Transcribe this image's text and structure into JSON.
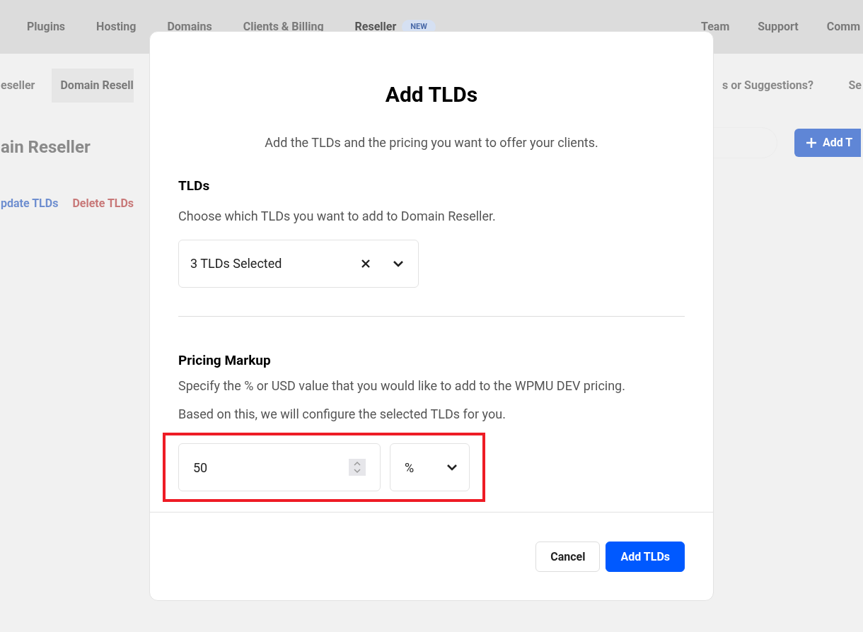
{
  "nav": {
    "items": [
      {
        "label": "Plugins",
        "selected": false
      },
      {
        "label": "Hosting",
        "selected": false
      },
      {
        "label": "Domains",
        "selected": false
      },
      {
        "label": "Clients & Billing",
        "selected": false
      },
      {
        "label": "Reseller",
        "selected": true,
        "badge": "NEW"
      }
    ],
    "right_items": [
      {
        "label": "Team",
        "selected": false
      },
      {
        "label": "Support",
        "selected": false
      },
      {
        "label": "Comm",
        "selected": false
      }
    ]
  },
  "subnav": {
    "left": [
      {
        "label": "eseller",
        "selected": false
      },
      {
        "label": "Domain Resell",
        "selected": true
      }
    ],
    "right": [
      "s or Suggestions?",
      "Se"
    ]
  },
  "page": {
    "title": "ain Reseller",
    "actions": [
      {
        "label": "pdate TLDs",
        "kind": "link"
      },
      {
        "label": "Delete TLDs",
        "kind": "danger"
      }
    ],
    "add_button": "Add T"
  },
  "modal": {
    "title": "Add TLDs",
    "description": "Add the TLDs and the pricing you want to offer your clients.",
    "tlds": {
      "heading": "TLDs",
      "description": "Choose which TLDs you want to add to Domain Reseller.",
      "select": {
        "value": "3 TLDs Selected"
      }
    },
    "pricing": {
      "heading": "Pricing Markup",
      "description": "Specify the % or USD value that you would like to add to the WPMU DEV pricing. Based on this, we will configure the selected TLDs for you.",
      "value": "50",
      "unit": "%",
      "highlighted": true
    },
    "buttons": [
      {
        "label": "Cancel",
        "kind": "secondary"
      },
      {
        "label": "Add TLDs",
        "kind": "primary"
      }
    ]
  }
}
